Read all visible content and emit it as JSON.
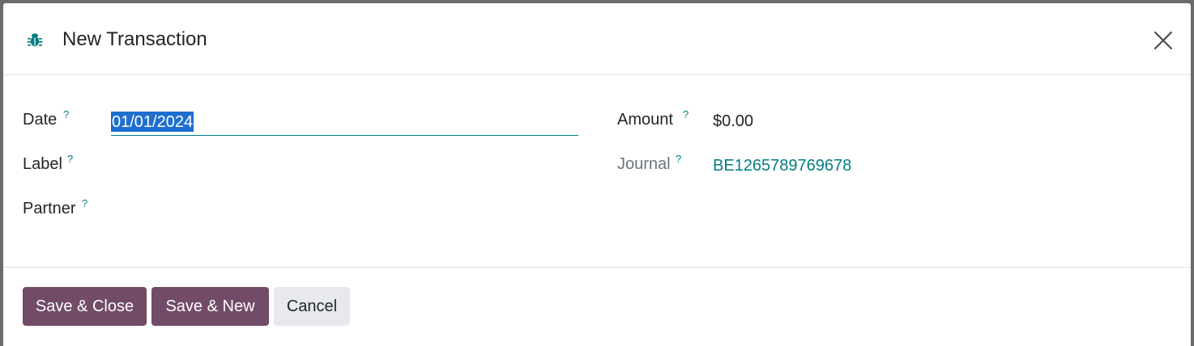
{
  "dialog": {
    "title": "New Transaction",
    "icon": "bug-icon",
    "close_icon": "close-icon"
  },
  "form": {
    "date": {
      "label": "Date",
      "help": "?",
      "value": "01/01/2024"
    },
    "label": {
      "label": "Label",
      "help": "?",
      "value": ""
    },
    "partner": {
      "label": "Partner",
      "help": "?",
      "value": ""
    },
    "amount": {
      "label": "Amount",
      "help": "?",
      "value": "$0.00"
    },
    "journal": {
      "label": "Journal",
      "help": "?",
      "value": "BE1265789769678"
    }
  },
  "footer": {
    "save_close": "Save & Close",
    "save_new": "Save & New",
    "cancel": "Cancel"
  },
  "colors": {
    "primary": "#714b67",
    "accent": "#017e84",
    "selection": "#1e6fd0"
  }
}
